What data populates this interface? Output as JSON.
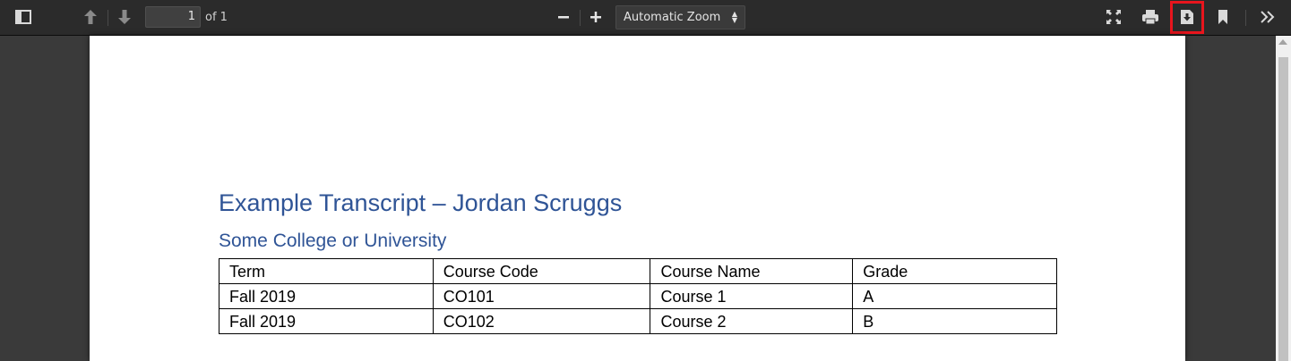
{
  "toolbar": {
    "page_number": "1",
    "page_of": "of 1",
    "zoom_label": "Automatic Zoom",
    "icons": [
      "sidebar-toggle-icon",
      "previous-page-icon",
      "next-page-icon",
      "zoom-out-icon",
      "zoom-in-icon",
      "presentation-mode-icon",
      "print-icon",
      "download-icon",
      "bookmark-icon",
      "tools-icon"
    ],
    "highlight_color": "#e8151d"
  },
  "document": {
    "title": "Example Transcript – Jordan Scruggs",
    "subtitle": "Some College or University",
    "heading_color": "#2f5496",
    "table": {
      "headers": [
        "Term",
        "Course Code",
        "Course Name",
        "Grade"
      ],
      "rows": [
        [
          "Fall 2019",
          "CO101",
          "Course 1",
          "A"
        ],
        [
          "Fall 2019",
          "CO102",
          "Course 2",
          "B"
        ]
      ]
    }
  }
}
